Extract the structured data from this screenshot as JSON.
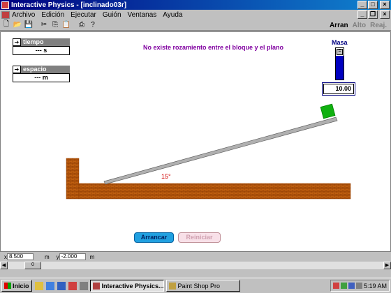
{
  "window": {
    "title": "Interactive Physics - [inclinado03r]"
  },
  "menu": [
    "Archivo",
    "Edición",
    "Ejecutar",
    "Guión",
    "Ventanas",
    "Ayuda"
  ],
  "toolbar": {
    "run_label": "Arran",
    "stop_label": "Alto",
    "reset_label": "Reaj."
  },
  "canvas": {
    "note": "No existe rozamiento entre el bloque y el plano",
    "meters": [
      {
        "label": "tiempo",
        "value": "--- s"
      },
      {
        "label": "espacio",
        "value": "--- m"
      }
    ],
    "mass": {
      "label": "Masa",
      "value": "10.00",
      "slider_fraction": 0.75
    },
    "angle_label": "15°",
    "colors": {
      "block": "#10b010",
      "ground": "#c06010",
      "ramp": "#b0b0b0",
      "note": "#8000a0"
    },
    "buttons": {
      "run": "Arrancar",
      "reset": "Reiniciar"
    }
  },
  "coords": {
    "x_prefix": "x",
    "x_value": "8.500",
    "x_unit": "m",
    "y_prefix": "y",
    "y_value": "-2.000",
    "y_unit": "m"
  },
  "scroll": {
    "thumb_value": "0"
  },
  "taskbar": {
    "start": "Inicio",
    "tasks": [
      "Interactive Physics...",
      "Paint Shop Pro"
    ],
    "clock": "5:19 AM"
  }
}
